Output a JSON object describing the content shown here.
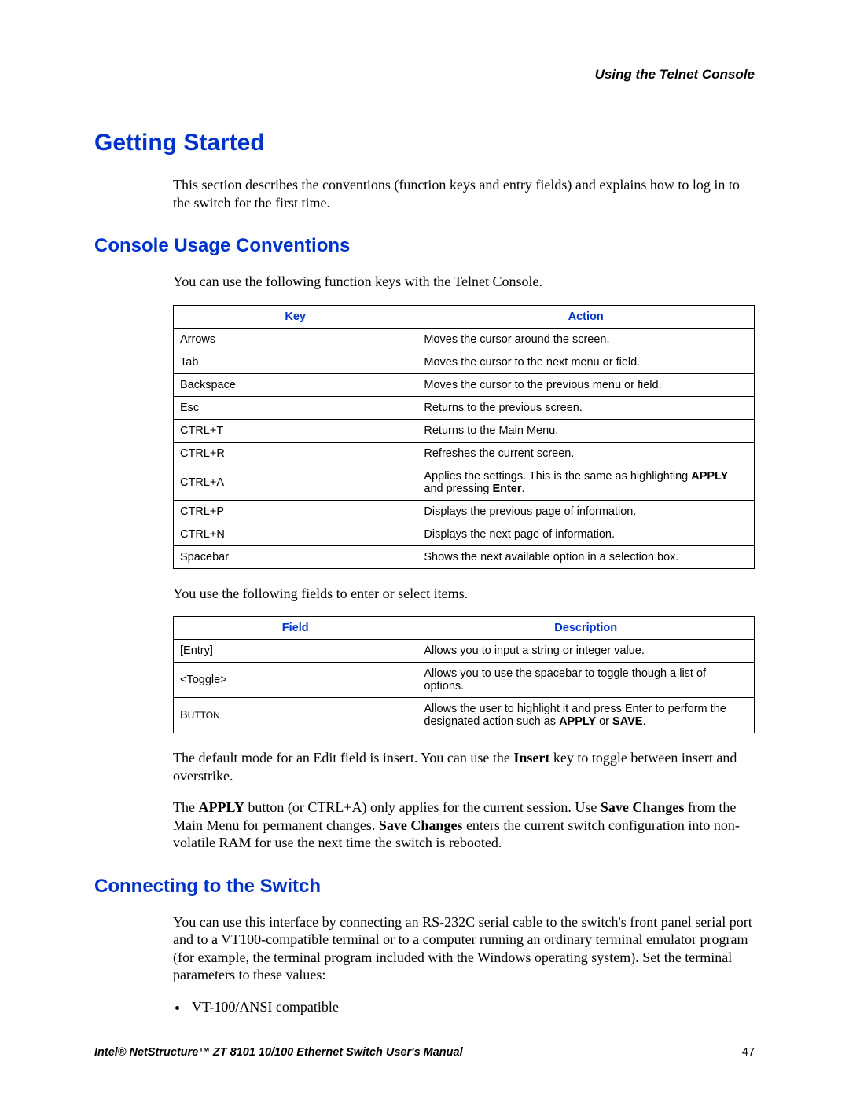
{
  "header": {
    "running": "Using the Telnet Console"
  },
  "h1": "Getting Started",
  "intro": "This section describes the conventions (function keys and entry fields) and explains how to log in to the switch for the first time.",
  "h2a": "Console Usage Conventions",
  "conv_intro": "You can use the following function keys with the Telnet Console.",
  "table1": {
    "headers": {
      "key": "Key",
      "action": "Action"
    },
    "rows": [
      {
        "key": "Arrows",
        "action": "Moves the cursor around the screen."
      },
      {
        "key": "Tab",
        "action": "Moves the cursor to the next menu or field."
      },
      {
        "key": "Backspace",
        "action": "Moves the cursor to the previous menu or field."
      },
      {
        "key": "Esc",
        "action": "Returns to the previous screen."
      },
      {
        "key": "CTRL+T",
        "action": "Returns to the Main Menu."
      },
      {
        "key": "CTRL+R",
        "action": "Refreshes the current screen."
      },
      {
        "key": "CTRL+A",
        "action_pre": "Applies the settings. This is the same as highlighting ",
        "action_bold1": "APPLY",
        "action_mid": " and pressing ",
        "action_bold2": "Enter",
        "action_post": "."
      },
      {
        "key": "CTRL+P",
        "action": "Displays the previous page of information."
      },
      {
        "key": "CTRL+N",
        "action": "Displays the next page of information."
      },
      {
        "key": "Spacebar",
        "action": "Shows the next available option in a selection box."
      }
    ]
  },
  "fields_intro": "You use the following fields to enter or select items.",
  "table2": {
    "headers": {
      "field": "Field",
      "desc": "Description"
    },
    "rows": [
      {
        "field": "[Entry]",
        "desc": "Allows you to input a string or integer value."
      },
      {
        "field": "<Toggle>",
        "desc": "Allows you to use the spacebar to toggle though a list of options."
      },
      {
        "field_pre": "B",
        "field_sc": "UTTON",
        "desc_pre": "Allows the user to highlight it and press Enter to perform the designated action such as ",
        "desc_bold1": "APPLY",
        "desc_mid": " or ",
        "desc_bold2": "SAVE",
        "desc_post": "."
      }
    ]
  },
  "para_insert_pre": "The default mode for an Edit field is insert. You can use the ",
  "para_insert_bold": "Insert",
  "para_insert_post": " key to toggle between insert and overstrike.",
  "para_apply_1": "The ",
  "para_apply_b1": "APPLY",
  "para_apply_2": " button (or CTRL+A) only applies for the current session. Use ",
  "para_apply_b2": "Save Changes",
  "para_apply_3": " from the Main Menu for permanent changes. ",
  "para_apply_b3": "Save Changes",
  "para_apply_4": " enters the current switch configuration into non-volatile RAM for use the next time the switch is rebooted.",
  "h2b": "Connecting to the Switch",
  "connect_para": "You can use this interface by connecting an RS-232C serial cable to the switch's front panel serial port and to a VT100-compatible terminal or to a computer running an ordinary terminal emulator program (for example, the terminal program included with the Windows operating system). Set the terminal parameters to these values:",
  "bullet1": "VT-100/ANSI compatible",
  "footer": {
    "title": "Intel® NetStructure™  ZT 8101 10/100 Ethernet Switch User's Manual",
    "page": "47"
  }
}
